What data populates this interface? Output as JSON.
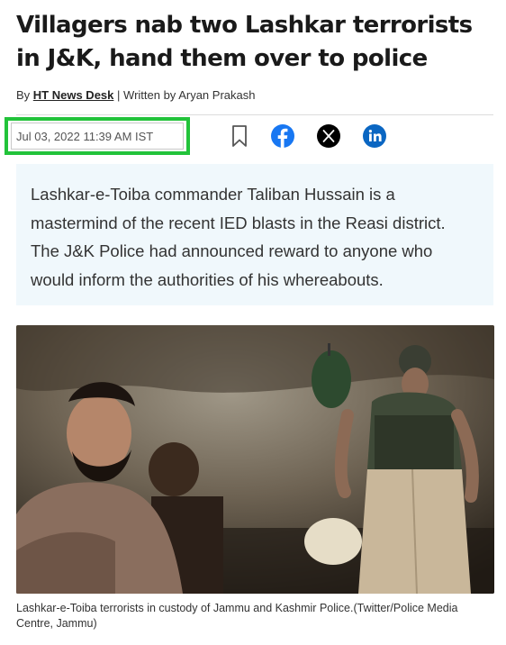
{
  "article": {
    "headline": "Villagers nab two Lashkar terrorists in J&K, hand them over to police",
    "byline_prefix": "By",
    "byline_author": "HT News Desk",
    "byline_separator": "|",
    "byline_written": "Written by Aryan Prakash",
    "date": "Jul 03, 2022 11:39 AM IST",
    "summary": "Lashkar-e-Toiba commander Taliban Hussain is a mastermind of the recent IED blasts in the Reasi district. The J&K Police had announced reward to anyone who would inform the authorities of his whereabouts.",
    "caption": "Lashkar-e-Toiba terrorists in custody of Jammu and Kashmir Police.(Twitter/Police Media Centre, Jammu)"
  },
  "share": {
    "bookmark_icon": "bookmark-icon",
    "facebook_icon": "facebook-icon",
    "x_icon": "x-icon",
    "linkedin_icon": "linkedin-icon",
    "facebook_color": "#1877f2",
    "x_color": "#000000",
    "linkedin_color": "#0a66c2"
  },
  "colors": {
    "highlight_box": "#22c33a",
    "summary_bg": "#f0f8fc"
  }
}
